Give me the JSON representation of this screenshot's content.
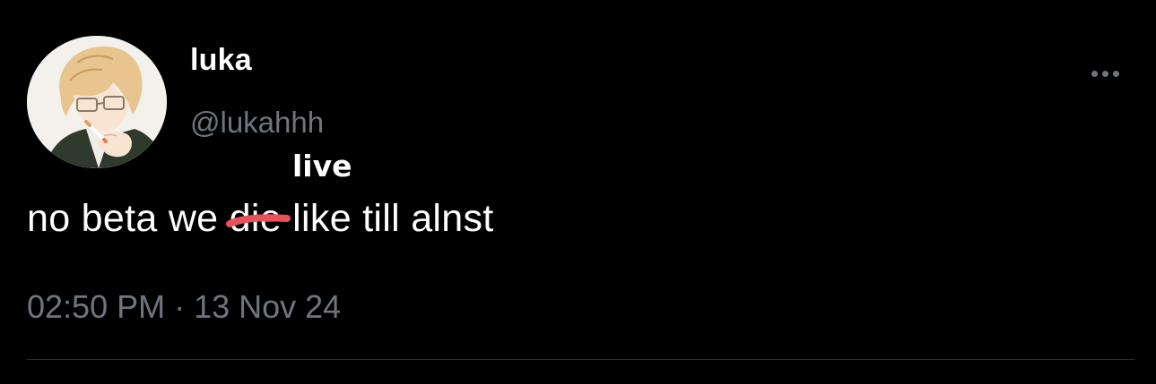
{
  "tweet": {
    "display_name": "luka",
    "handle": "@lukahhh",
    "text_before": "no beta we ",
    "struck_word": "die",
    "text_after": " like till alnst",
    "correction": "live",
    "timestamp": "02:50 PM · 13 Nov 24",
    "more_icon": "more-horizontal-icon"
  },
  "colors": {
    "background": "#000000",
    "primary_text": "#ffffff",
    "secondary_text": "#6e767d",
    "strike_mark": "#e8505b",
    "divider": "#2f3336"
  }
}
